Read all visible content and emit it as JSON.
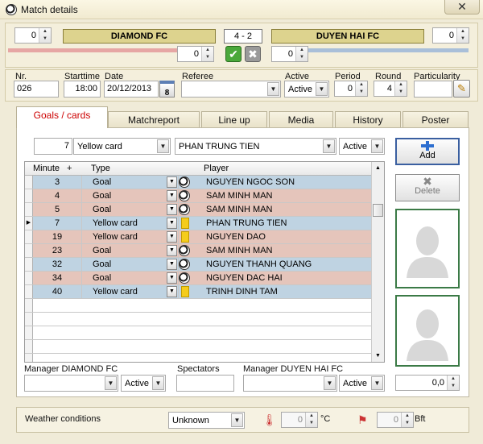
{
  "window": {
    "title": "Match details",
    "close_glyph": "✕"
  },
  "score": {
    "home_spin": "0",
    "home_team": "DIAMOND FC",
    "result": "4  - 2",
    "away_team": "DUYEN HAI FC",
    "away_spin": "0",
    "home_score_input": "0",
    "away_score_input": "0"
  },
  "info": {
    "nr_label": "Nr.",
    "nr_value": "026",
    "starttime_label": "Starttime",
    "starttime_value": "18:00",
    "date_label": "Date",
    "date_value": "20/12/2013",
    "calendar_glyph": "8",
    "referee_label": "Referee",
    "referee_value": "",
    "active_label": "Active",
    "active_value": "Active",
    "period_label": "Period",
    "period_value": "0",
    "round_label": "Round",
    "round_value": "4",
    "particularity_label": "Particularity",
    "particularity_value": ""
  },
  "tabs": [
    {
      "label": "Goals / cards",
      "active": true
    },
    {
      "label": "Matchreport"
    },
    {
      "label": "Line up"
    },
    {
      "label": "Media"
    },
    {
      "label": "History"
    },
    {
      "label": "Poster"
    }
  ],
  "entry": {
    "minute": "7",
    "type": "Yellow card",
    "player": "PHAN TRUNG TIEN",
    "status": "Active"
  },
  "grid": {
    "headers": {
      "minute": "Minute",
      "add": "+",
      "type": "Type",
      "player": "Player"
    },
    "rows": [
      {
        "minute": "3",
        "type": "Goal",
        "player": "NGUYEN NGOC SON",
        "color": "blue",
        "icon": "ball"
      },
      {
        "minute": "4",
        "type": "Goal",
        "player": "SAM MINH MAN",
        "color": "pink",
        "icon": "ball"
      },
      {
        "minute": "5",
        "type": "Goal",
        "player": "SAM MINH MAN",
        "color": "pink",
        "icon": "ball"
      },
      {
        "minute": "7",
        "type": "Yellow card",
        "player": "PHAN TRUNG TIEN",
        "color": "blue",
        "icon": "yellow",
        "current": true
      },
      {
        "minute": "19",
        "type": "Yellow card",
        "player": "NGUYEN DAO",
        "color": "pink",
        "icon": "yellow"
      },
      {
        "minute": "23",
        "type": "Goal",
        "player": "SAM MINH MAN",
        "color": "pink",
        "icon": "ball"
      },
      {
        "minute": "32",
        "type": "Goal",
        "player": "NGUYEN THANH QUANG",
        "color": "blue",
        "icon": "ball"
      },
      {
        "minute": "34",
        "type": "Goal",
        "player": "NGUYEN DAC HAI",
        "color": "pink",
        "icon": "ball"
      },
      {
        "minute": "40",
        "type": "Yellow card",
        "player": "TRINH DINH TAM",
        "color": "blue",
        "icon": "yellow"
      }
    ],
    "empty_rows": 5
  },
  "buttons": {
    "add": "Add",
    "delete": "Delete"
  },
  "managers": {
    "home_label": "Manager DIAMOND FC",
    "home_value": "",
    "home_status": "Active",
    "spectators_label": "Spectators",
    "spectators_value": "",
    "away_label": "Manager DUYEN HAI FC",
    "away_value": "",
    "away_status": "Active",
    "amount": "0,0"
  },
  "weather": {
    "label": "Weather conditions",
    "condition": "Unknown",
    "temperature": "0",
    "temp_unit": "°C",
    "wind": "0",
    "wind_unit": "Bft"
  },
  "colors": {
    "accent_red": "#cc0000",
    "team_bar": "#ddd38e",
    "row_blue": "#bfd3e2",
    "row_pink": "#e5c5bb",
    "photo_border": "#3b7a46"
  }
}
